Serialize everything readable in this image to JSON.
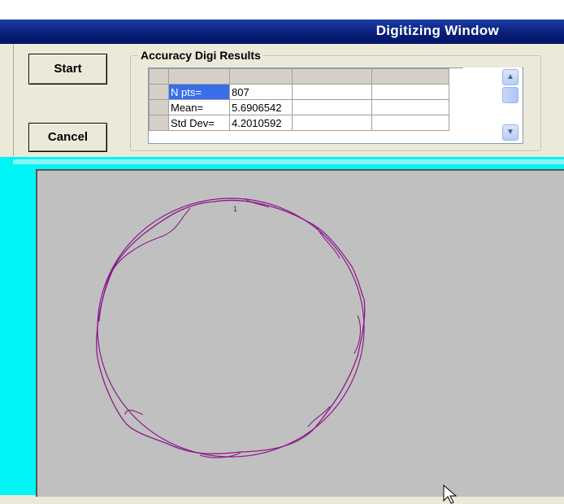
{
  "window": {
    "title": "Digitizing Window"
  },
  "buttons": {
    "start": "Start",
    "cancel": "Cancel"
  },
  "results": {
    "group_label": "Accuracy Digi Results",
    "rows": [
      {
        "label": "N pts=",
        "value": "807"
      },
      {
        "label": "Mean=",
        "value": "5.6906542"
      },
      {
        "label": "Std Dev=",
        "value": "4.2010592"
      }
    ]
  },
  "canvas": {
    "point_label": "1",
    "trace_color": "#8b1a8b",
    "background": "#c0c0c0"
  },
  "colors": {
    "title_bar": "#0a1f7a",
    "frame": "#00f6f6",
    "selection": "#3a6ee8"
  }
}
